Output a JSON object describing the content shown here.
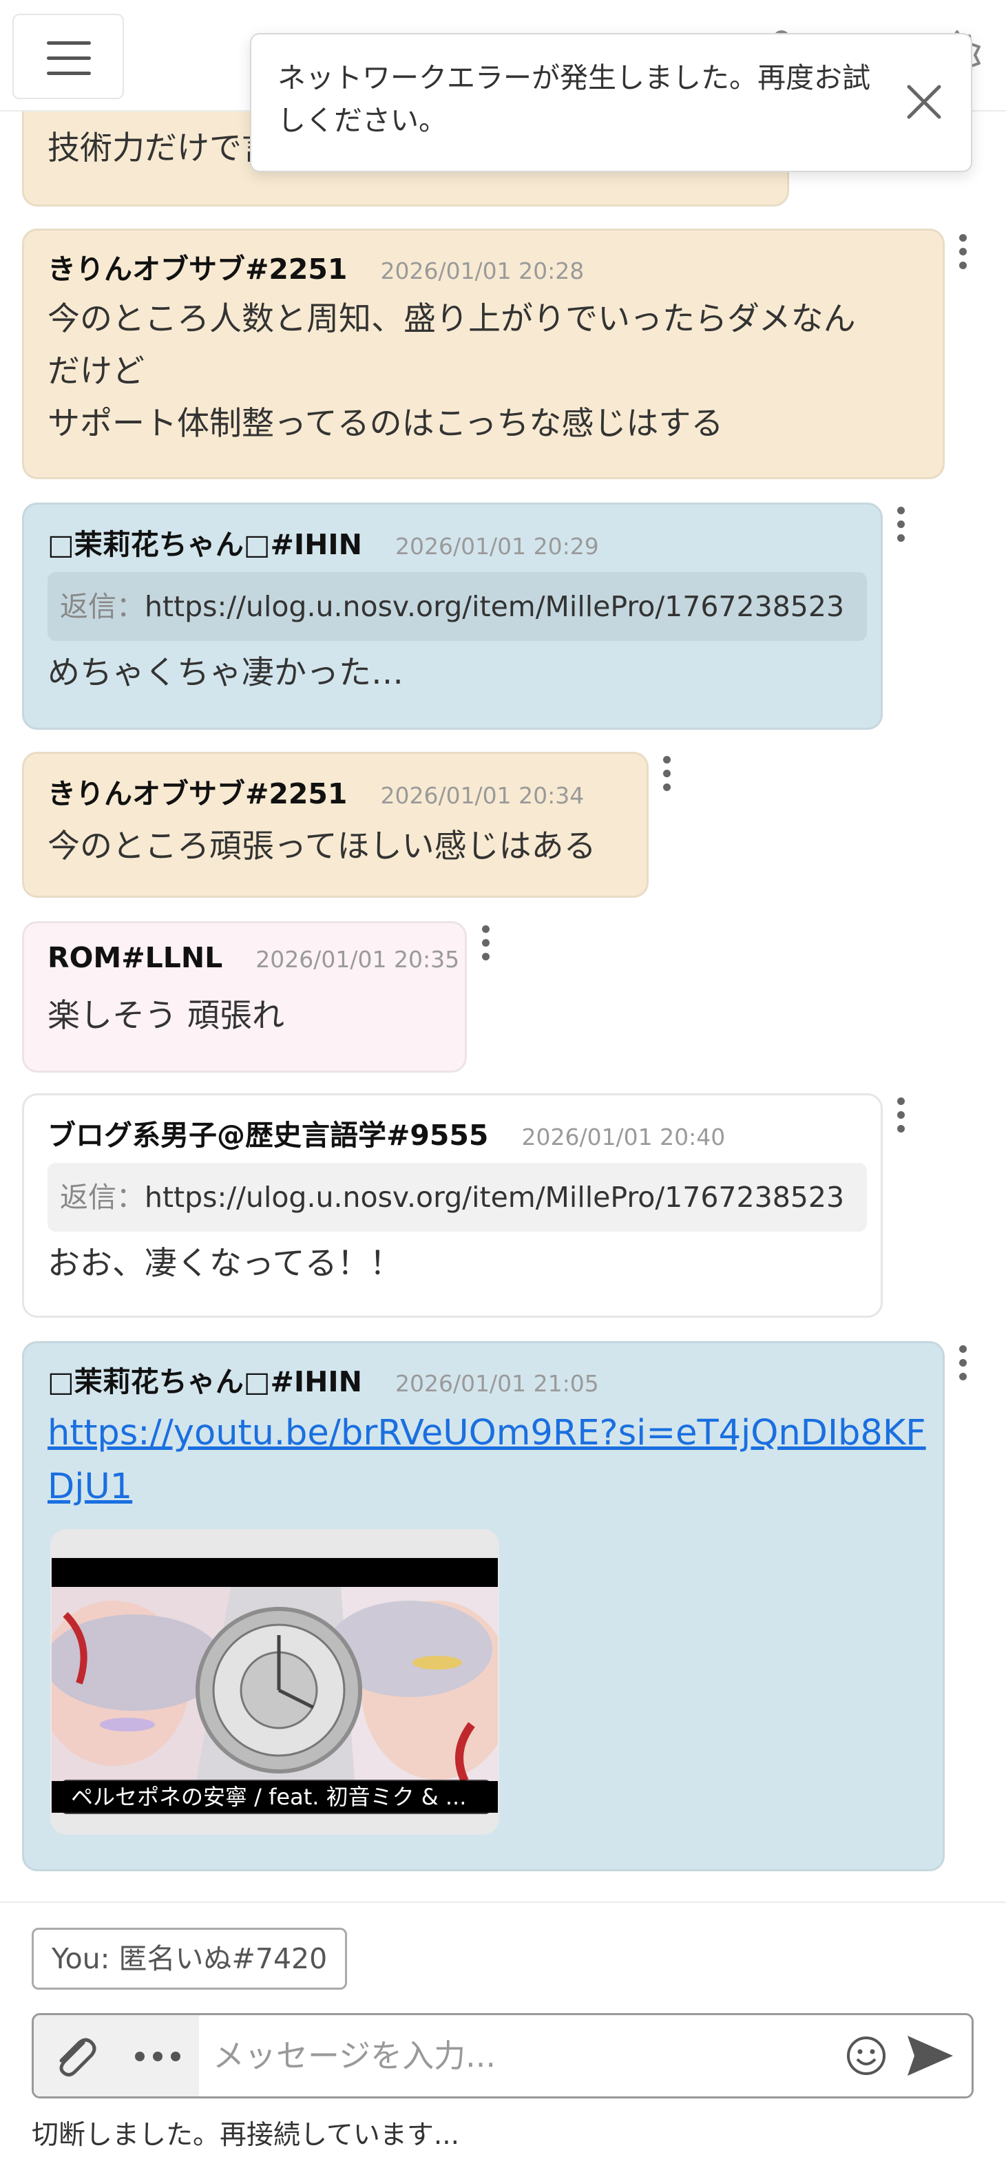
{
  "toast": {
    "message_line1": "ネットワークエラーが発生しました。再度お試",
    "message_line2": "しください。"
  },
  "messages": [
    {
      "variant": "orange",
      "body_lines": [
        "技術力だけで言ったら軍配上がってる"
      ]
    },
    {
      "variant": "orange",
      "author": "きりんオブサブ#2251",
      "time": "2026/01/01 20:28",
      "body_lines": [
        "今のところ人数と周知、盛り上がりでいったらダメなん",
        "だけど",
        "サポート体制整ってるのはこっちな感じはする"
      ]
    },
    {
      "variant": "blue",
      "author": "□茉莉花ちゃん□#IHIN",
      "time": "2026/01/01 20:29",
      "reply_prefix": "返信：",
      "reply_url": "https://ulog.u.nosv.org/item/MillePro/1767238523",
      "body_lines": [
        "めちゃくちゃ凄かった…"
      ]
    },
    {
      "variant": "orange",
      "author": "きりんオブサブ#2251",
      "time": "2026/01/01 20:34",
      "body_lines": [
        "今のところ頑張ってほしい感じはある"
      ]
    },
    {
      "variant": "pink",
      "author": "ROM#LLNL",
      "time": "2026/01/01 20:35",
      "body_lines": [
        "楽しそう 頑張れ"
      ]
    },
    {
      "variant": "white",
      "author": "ブログ系男子@歴史言語学#9555",
      "time": "2026/01/01 20:40",
      "reply_prefix": "返信：",
      "reply_url": "https://ulog.u.nosv.org/item/MillePro/1767238523",
      "body_lines": [
        "おお、凄くなってる！！"
      ]
    },
    {
      "variant": "blue",
      "author": "□茉莉花ちゃん□#IHIN",
      "time": "2026/01/01 21:05",
      "link": "https://youtu.be/brRVeUOm9RE?si=eT4jQnDIb8KFDjU1",
      "link_line1": "https://youtu.be/brRVeUOm9RE?si=eT4jQnDIb8KF",
      "link_line2": "DjU1",
      "video_title": "ペルセポネの安寧 / feat. 初音ミク & ..."
    }
  ],
  "composer": {
    "identity": "You: 匿名いぬ#7420",
    "placeholder": "メッセージを入力...",
    "status": "切断しました。再接続しています..."
  },
  "icons": {
    "menu": "hamburger-menu-icon",
    "user": "user-icon",
    "share": "share-icon",
    "search": "search-icon",
    "settings": "gear-icon",
    "close": "close-icon",
    "more": "more-vertical-icon",
    "attach": "paperclip-icon",
    "emoji": "emoji-icon",
    "send": "send-icon"
  },
  "colors": {
    "orange_bubble": "#f8ead2",
    "blue_bubble": "#d3e5ec",
    "pink_bubble": "#fdf2f5",
    "link": "#1a6fe0"
  }
}
